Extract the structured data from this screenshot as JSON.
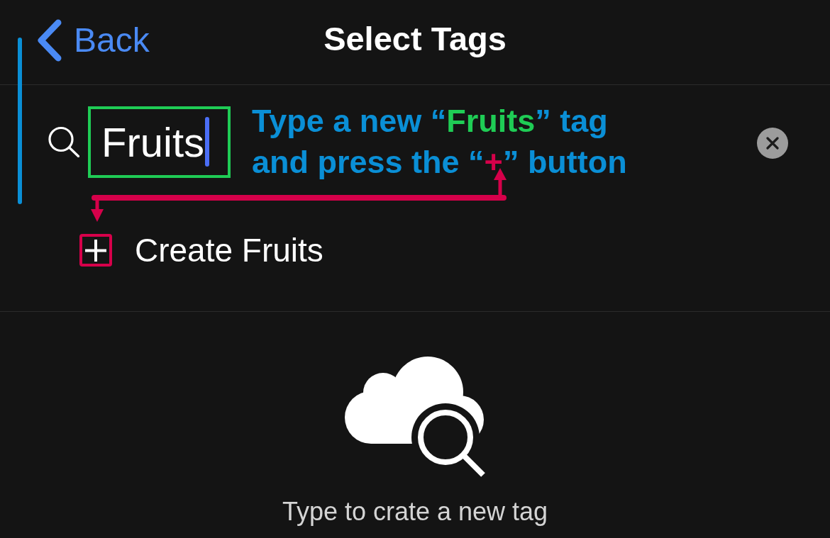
{
  "nav": {
    "back_label": "Back",
    "title": "Select Tags"
  },
  "search": {
    "value": "Fruits",
    "focused": true,
    "highlighted": true
  },
  "instruction": {
    "lines": [
      {
        "segments": [
          {
            "text": "Type a new “",
            "color": "#0a8fd6"
          },
          {
            "text": "Fruits",
            "color": "#1fcc55"
          },
          {
            "text": "” tag",
            "color": "#0a8fd6"
          }
        ]
      },
      {
        "segments": [
          {
            "text": "and press the “",
            "color": "#0a8fd6"
          },
          {
            "text": "+",
            "color": "#d6004a"
          },
          {
            "text": "” button",
            "color": "#0a8fd6"
          }
        ]
      }
    ]
  },
  "create_option": {
    "label": "Create Fruits",
    "highlighted": true
  },
  "empty_state": {
    "message": "Type to crate a new tag"
  }
}
